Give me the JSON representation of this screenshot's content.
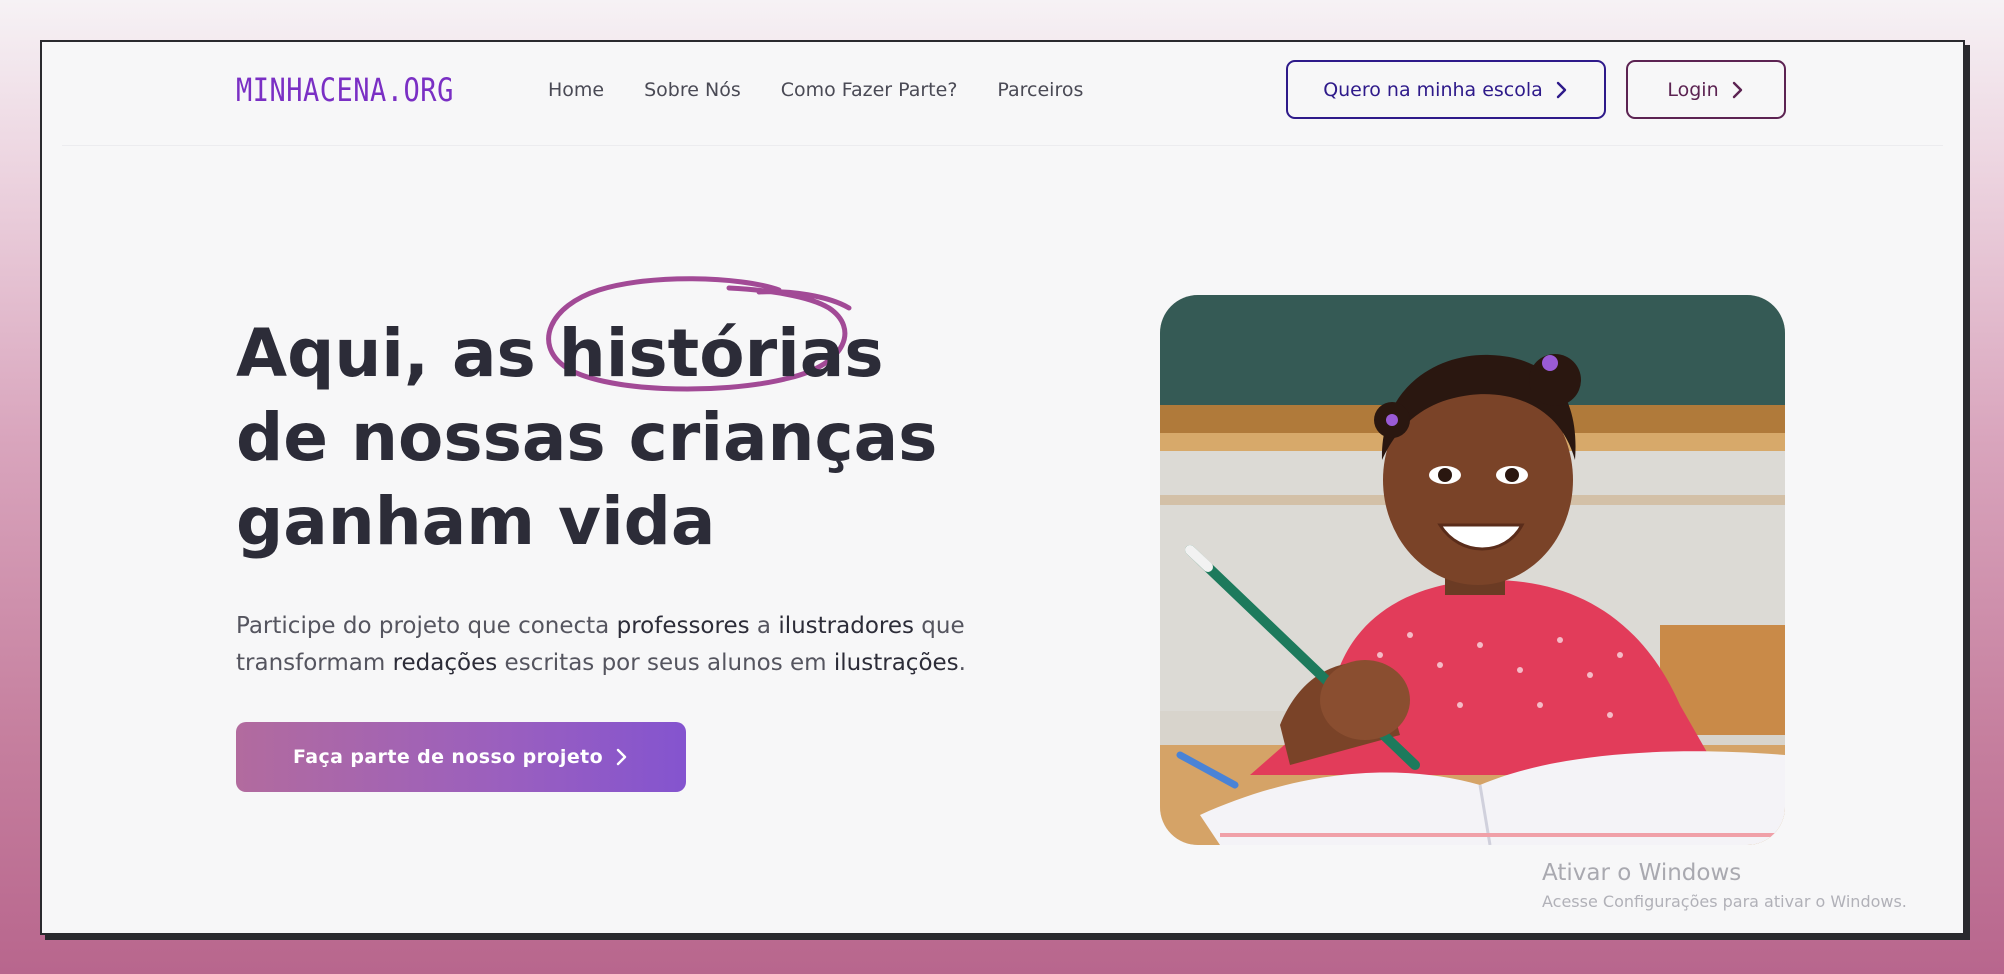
{
  "brand": {
    "logo_text": "MINHACENA.ORG",
    "accent": "#7a2fc4"
  },
  "nav": {
    "links": [
      {
        "label": "Home"
      },
      {
        "label": "Sobre Nós"
      },
      {
        "label": "Como Fazer Parte?"
      },
      {
        "label": "Parceiros"
      }
    ],
    "school_button": "Quero na minha escola",
    "login_button": "Login"
  },
  "hero": {
    "title_prefix": "Aqui, as ",
    "title_highlight": "histórias",
    "title_line2": "de nossas crianças",
    "title_line3": "ganham vida",
    "subtitle_parts": [
      "Participe do projeto que conecta ",
      "professores",
      " a ",
      "ilustradores",
      " que transformam ",
      "redações",
      " escritas por seus alunos em ",
      "ilustrações",
      "."
    ],
    "cta_label": "Faça parte de nosso projeto",
    "highlight_color": "#a24a96"
  },
  "os_watermark": {
    "title": "Ativar o Windows",
    "subtitle": "Acesse Configurações para ativar o Windows."
  }
}
